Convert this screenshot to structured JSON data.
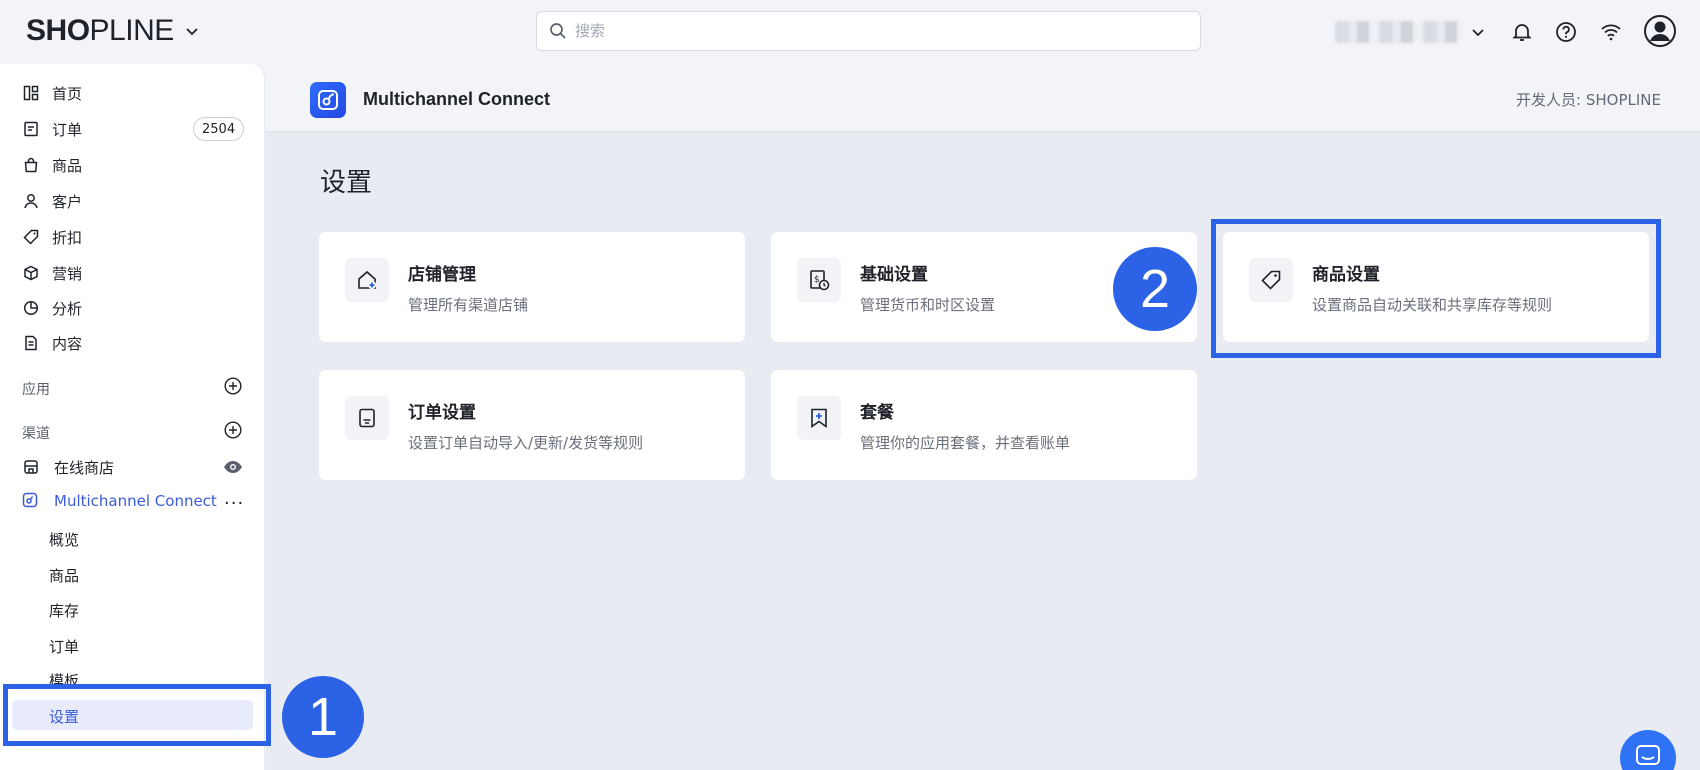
{
  "topbar": {
    "logo_prefix": "SH",
    "logo_o": "O",
    "logo_mid": "P",
    "logo_suffix": "LINE",
    "search_placeholder": "搜索",
    "icons": [
      "chevron-down-icon",
      "search-icon",
      "bell-icon",
      "help-icon",
      "wifi-icon",
      "user-avatar-icon"
    ]
  },
  "sidebar": {
    "items": [
      {
        "label": "首页",
        "icon": "dashboard-icon"
      },
      {
        "label": "订单",
        "icon": "order-icon",
        "badge": "2504"
      },
      {
        "label": "商品",
        "icon": "bag-icon"
      },
      {
        "label": "客户",
        "icon": "person-icon"
      },
      {
        "label": "折扣",
        "icon": "tag-icon"
      },
      {
        "label": "营销",
        "icon": "box-icon"
      },
      {
        "label": "分析",
        "icon": "pie-chart-icon"
      },
      {
        "label": "内容",
        "icon": "document-icon"
      }
    ],
    "apps_label": "应用",
    "channels_label": "渠道",
    "online_store": "在线商店",
    "multichannel": "Multichannel Connect",
    "sub_items": [
      "概览",
      "商品",
      "库存",
      "订单",
      "模板",
      "设置"
    ]
  },
  "app": {
    "title": "Multichannel Connect",
    "developer": "开发人员: SHOPLINE"
  },
  "page": {
    "title": "设置",
    "cards": [
      {
        "title": "店铺管理",
        "desc": "管理所有渠道店铺",
        "icon": "store-add-icon"
      },
      {
        "title": "基础设置",
        "desc": "管理货币和时区设置",
        "icon": "currency-clock-icon"
      },
      {
        "title": "商品设置",
        "desc": "设置商品自动关联和共享库存等规则",
        "icon": "tag-icon"
      },
      {
        "title": "订单设置",
        "desc": "设置订单自动导入/更新/发货等规则",
        "icon": "order-doc-icon"
      },
      {
        "title": "套餐",
        "desc": "管理你的应用套餐，并查看账单",
        "icon": "bookmark-plus-icon"
      }
    ]
  },
  "annotations": {
    "step1": "1",
    "step2": "2",
    "color": "#2b62e6"
  }
}
